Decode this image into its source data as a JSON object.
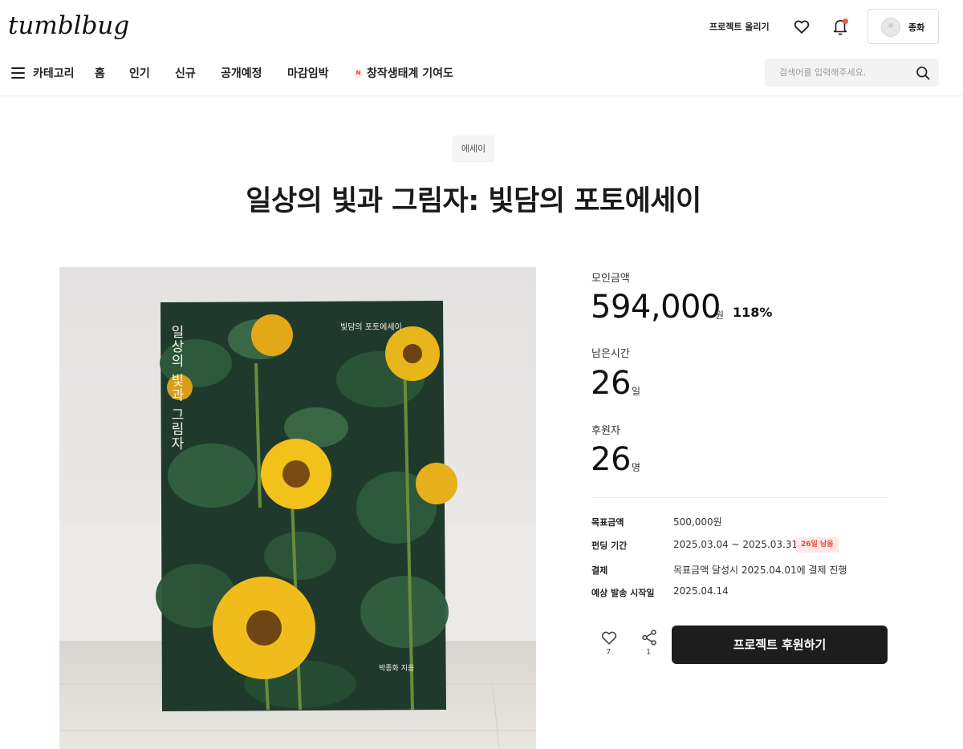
{
  "header": {
    "logo": "tumblbug",
    "upload_label": "프로젝트 올리기",
    "profile_name": "종화",
    "notification_dot_color": "#f05a4a"
  },
  "nav": {
    "category_label": "카테고리",
    "items": [
      "홈",
      "인기",
      "신규",
      "공개예정",
      "마감임박"
    ],
    "special_badge": "N",
    "special_label": "창작생태계 기여도"
  },
  "search": {
    "placeholder": "검색어를 입력해주세요."
  },
  "project": {
    "category": "에세이",
    "title": "일상의 빛과 그림자: 빛담의 포토에세이",
    "cover": {
      "title": "일상의 빛과 그림자",
      "subtitle": "빛담의 포토에세이",
      "author": "박종화 지음"
    }
  },
  "stats": {
    "amount_label": "모인금액",
    "amount": "594,000",
    "amount_unit": "원",
    "percent": "118%",
    "time_label": "남은시간",
    "time": "26",
    "time_unit": "일",
    "backers_label": "후원자",
    "backers": "26",
    "backers_unit": "명"
  },
  "info": {
    "goal_label": "목표금액",
    "goal_value": "500,000원",
    "period_label": "펀딩 기간",
    "period_value": "2025.03.04 ~ 2025.03.31",
    "period_badge": "26일 남음",
    "payment_label": "결제",
    "payment_value": "목표금액 달성시 2025.04.01에 결제 진행",
    "ship_label": "예상 발송 시작일",
    "ship_value": "2025.04.14"
  },
  "actions": {
    "like_count": "7",
    "share_count": "1",
    "back_label": "프로젝트 후원하기"
  },
  "colors": {
    "accent_red": "#e2483a",
    "button_dark": "#1d1d1d"
  }
}
